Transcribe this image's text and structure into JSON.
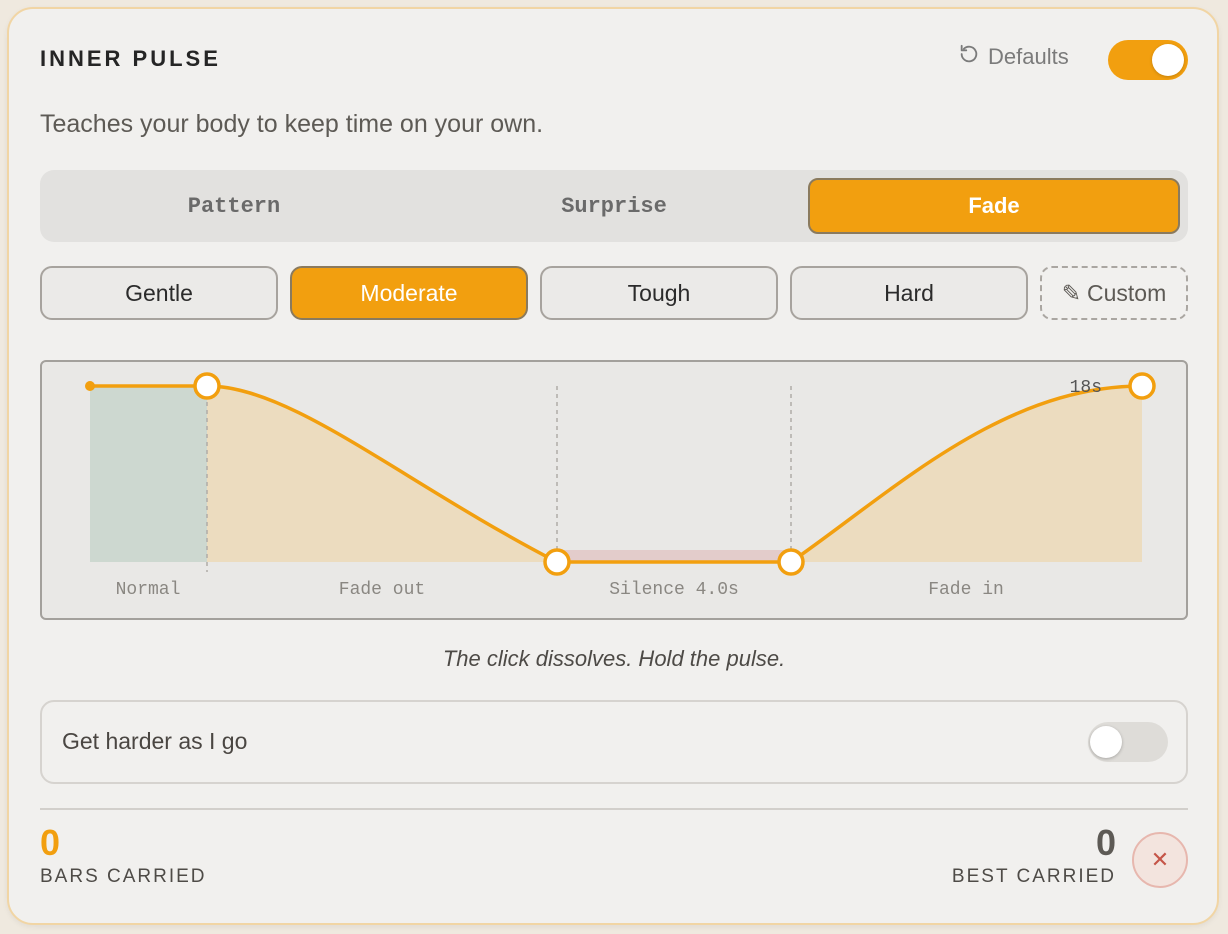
{
  "header": {
    "title": "INNER PULSE",
    "defaults_label": "Defaults",
    "enabled": true
  },
  "subtitle": "Teaches your body to keep time on your own.",
  "tabs": [
    {
      "label": "Pattern",
      "active": false
    },
    {
      "label": "Surprise",
      "active": false
    },
    {
      "label": "Fade",
      "active": true
    }
  ],
  "levels": [
    {
      "label": "Gentle",
      "active": false
    },
    {
      "label": "Moderate",
      "active": true
    },
    {
      "label": "Tough",
      "active": false
    },
    {
      "label": "Hard",
      "active": false
    },
    {
      "label": "Custom",
      "icon": "pencil-icon",
      "active": false
    }
  ],
  "fade_curve": {
    "total_label": "18s",
    "phases": [
      "Normal",
      "Fade out",
      "Silence 4.0s",
      "Fade in"
    ]
  },
  "caption": "The click dissolves. Hold the pulse.",
  "harder": {
    "label": "Get harder as I go",
    "enabled": false
  },
  "stats": {
    "bars_carried": "0",
    "bars_carried_label": "BARS CARRIED",
    "best_carried": "0",
    "best_carried_label": "BEST CARRIED"
  },
  "colors": {
    "accent": "#f29f0f",
    "normal_zone": "#cdd8d0",
    "fade_fill": "#ecdcbf",
    "silence_band": "#e3cccb"
  }
}
